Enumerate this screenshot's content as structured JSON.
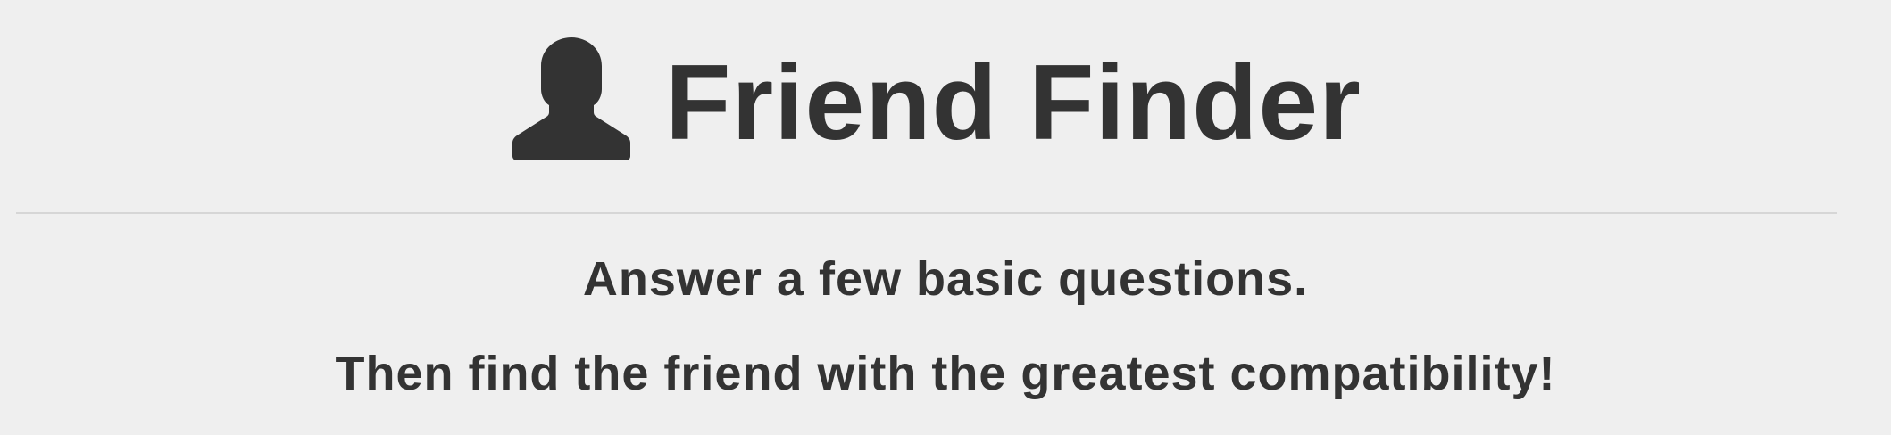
{
  "header": {
    "icon": "user-icon",
    "title": "Friend Finder"
  },
  "intro": {
    "line1": "Answer a few basic questions.",
    "line2": "Then find the friend with the greatest compatibility!"
  },
  "colors": {
    "background": "#efefef",
    "text": "#333333",
    "divider": "#d6d6d6"
  }
}
